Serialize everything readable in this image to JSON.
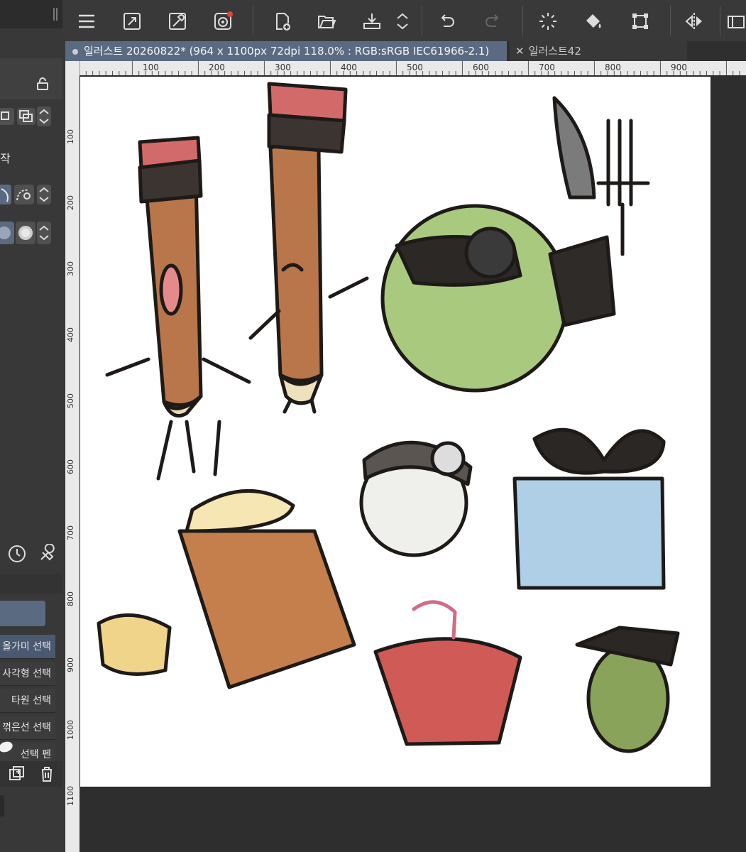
{
  "document_tab": {
    "title": "일러스트 20260822* (964 x 1100px 72dpi 118.0% : RGB:sRGB IEC61966-2.1)",
    "second_title": "일러스트42"
  },
  "left_panel": {
    "partial_label": "작",
    "selection_items": [
      "올가미 선택",
      "사각형 선택",
      "타원 선택",
      "꺾은선 선택",
      "선택 펜"
    ]
  },
  "ruler_top": [
    "100",
    "200",
    "300",
    "400",
    "500",
    "600",
    "700",
    "800",
    "900"
  ],
  "ruler_left": [
    "100",
    "200",
    "300",
    "400",
    "500",
    "600",
    "700",
    "800",
    "900",
    "1000",
    "1100"
  ],
  "toolbar_icons": [
    "menu-icon",
    "fullscreen-icon",
    "eyedropper-icon",
    "companion-icon",
    "new-file-icon",
    "open-folder-icon",
    "save-icon",
    "stepper-icon",
    "undo-icon",
    "redo-icon",
    "loading-icon",
    "fill-bucket-icon",
    "transform-icon",
    "flip-icon",
    "more-icon"
  ],
  "colors": {
    "toolbar_bg": "#393939",
    "active_tab": "#5a6a80",
    "canvas_bg": "#ffffff",
    "workspace_bg": "#2e2e2e",
    "accent_notification": "#e0443e"
  }
}
